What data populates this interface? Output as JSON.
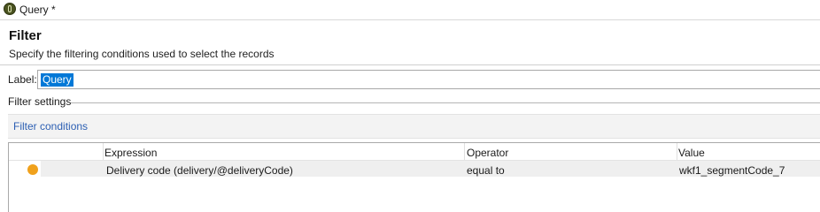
{
  "window": {
    "title": "Query *",
    "icon": "app-logo-icon"
  },
  "header": {
    "title": "Filter",
    "subtitle": "Specify the filtering conditions used to select the records"
  },
  "label_field": {
    "caption": "Label:",
    "value": "Query"
  },
  "filter_settings": {
    "caption": "Filter settings"
  },
  "filter_conditions": {
    "link_label": "Filter conditions"
  },
  "grid": {
    "columns": [
      "Expression",
      "Operator",
      "Value"
    ],
    "rows": [
      {
        "status_color": "#f0a11c",
        "expression": "Delivery code (delivery/@deliveryCode)",
        "operator": "equal to",
        "value": "wkf1_segmentCode_7"
      }
    ]
  },
  "colors": {
    "accent": "#0078d7",
    "link": "#2c5fb3",
    "status": "#f0a11c"
  }
}
